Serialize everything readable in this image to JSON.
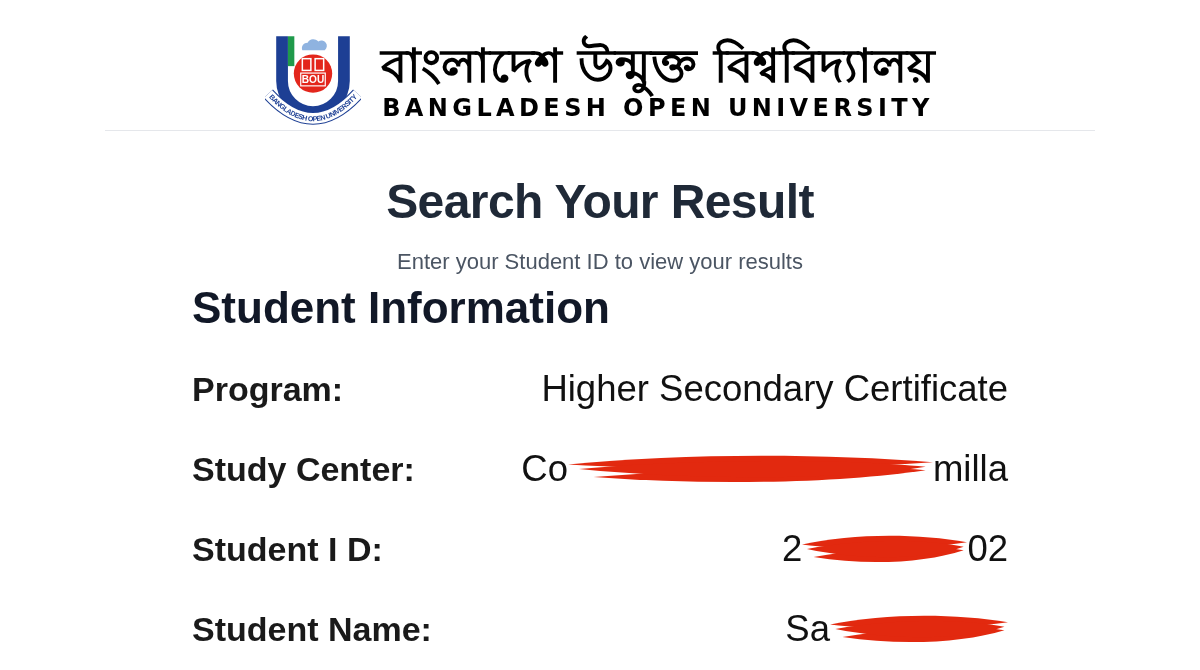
{
  "header": {
    "logo": {
      "mark": "BOU",
      "ring_text": "BANGLADESH OPEN UNIVERSITY"
    },
    "name_bengali": "বাংলাদেশ উন্মুক্ত বিশ্ববিদ্যালয়",
    "name_english": "BANGLADESH OPEN UNIVERSITY"
  },
  "page": {
    "title": "Search Your Result",
    "subtitle": "Enter your Student ID to view your results"
  },
  "student_information": {
    "heading": "Student Information",
    "rows": [
      {
        "label": "Program:",
        "value_parts": [
          "Higher Secondary Certificate"
        ],
        "redacted": false
      },
      {
        "label": "Study Center:",
        "value_parts": [
          "Co",
          "milla"
        ],
        "redacted": true
      },
      {
        "label": "Student I D:",
        "value_parts": [
          "2",
          "02"
        ],
        "redacted": true
      },
      {
        "label": "Student Name:",
        "value_parts": [
          "Sa"
        ],
        "redacted": true
      }
    ]
  }
}
